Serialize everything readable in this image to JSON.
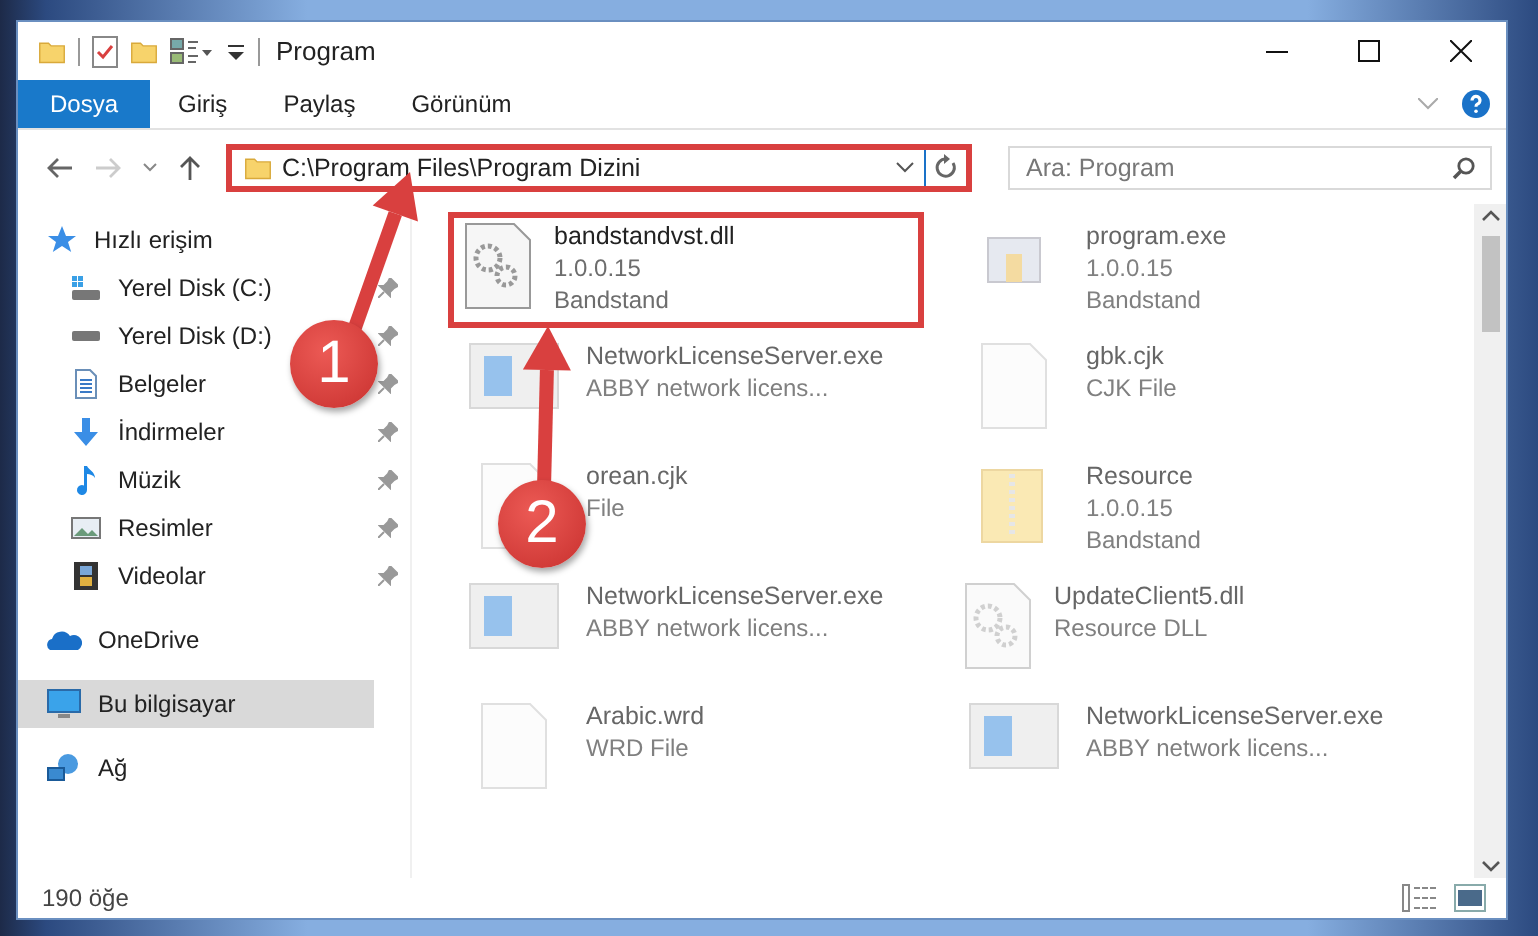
{
  "window": {
    "title": "Program"
  },
  "ribbon": {
    "tabs": [
      {
        "label": "Dosya",
        "kind": "file-menu"
      },
      {
        "label": "Giriş",
        "kind": "tab"
      },
      {
        "label": "Paylaş",
        "kind": "tab"
      },
      {
        "label": "Görünüm",
        "kind": "tab"
      }
    ]
  },
  "address_bar": {
    "path": "C:\\Program Files\\Program Dizini",
    "highlighted": true
  },
  "search": {
    "placeholder": "Ara: Program"
  },
  "sidebar": {
    "items": [
      {
        "label": "Hızlı erişim",
        "kind": "star",
        "selected": false,
        "children": [
          {
            "label": "Yerel Disk (C:)",
            "kind": "system-drive",
            "pinned": true,
            "selected": false
          },
          {
            "label": "Yerel Disk (D:)",
            "kind": "drive",
            "pinned": true,
            "selected": false
          },
          {
            "label": "Belgeler",
            "kind": "documents",
            "pinned": true,
            "selected": false
          },
          {
            "label": "İndirmeler",
            "kind": "downloads",
            "pinned": true,
            "selected": false
          },
          {
            "label": "Müzik",
            "kind": "music",
            "pinned": true,
            "selected": false
          },
          {
            "label": "Resimler",
            "kind": "pictures",
            "pinned": true,
            "selected": false
          },
          {
            "label": "Videolar",
            "kind": "videos",
            "pinned": true,
            "selected": false
          }
        ]
      },
      {
        "label": "OneDrive",
        "kind": "cloud",
        "selected": false
      },
      {
        "label": "Bu bilgisayar",
        "kind": "computer",
        "selected": true
      },
      {
        "label": "Ağ",
        "kind": "network",
        "selected": false
      }
    ]
  },
  "files": [
    {
      "name": "bandstandvst.dll",
      "details": [
        "1.0.0.15",
        "Bandstand"
      ],
      "kind": "gear-file",
      "highlighted": true
    },
    {
      "name": "program.exe",
      "details": [
        "1.0.0.15",
        "Bandstand"
      ],
      "kind": "program",
      "highlighted": false
    },
    {
      "name": "NetworkLicenseServer.exe",
      "details": [
        "ABBY network licens..."
      ],
      "kind": "window",
      "highlighted": false
    },
    {
      "name": "gbk.cjk",
      "details": [
        "CJK File"
      ],
      "kind": "blank-file",
      "highlighted": false
    },
    {
      "name": "orean.cjk",
      "details": [
        "File"
      ],
      "kind": "blank-file",
      "highlighted": false
    },
    {
      "name": "Resource",
      "details": [
        "1.0.0.15",
        "Bandstand"
      ],
      "kind": "folder",
      "highlighted": false
    },
    {
      "name": "NetworkLicenseServer.exe",
      "details": [
        "ABBY network licens..."
      ],
      "kind": "window",
      "highlighted": false
    },
    {
      "name": "UpdateClient5.dll",
      "details": [
        "Resource DLL"
      ],
      "kind": "gear-file",
      "highlighted": false
    },
    {
      "name": "Arabic.wrd",
      "details": [
        "WRD File"
      ],
      "kind": "blank-file",
      "highlighted": false
    },
    {
      "name": "NetworkLicenseServer.exe",
      "details": [
        "ABBY network licens..."
      ],
      "kind": "window",
      "highlighted": false
    }
  ],
  "status_bar": {
    "count": "190 öğe"
  },
  "annotations": [
    {
      "label": "1"
    },
    {
      "label": "2"
    }
  ]
}
